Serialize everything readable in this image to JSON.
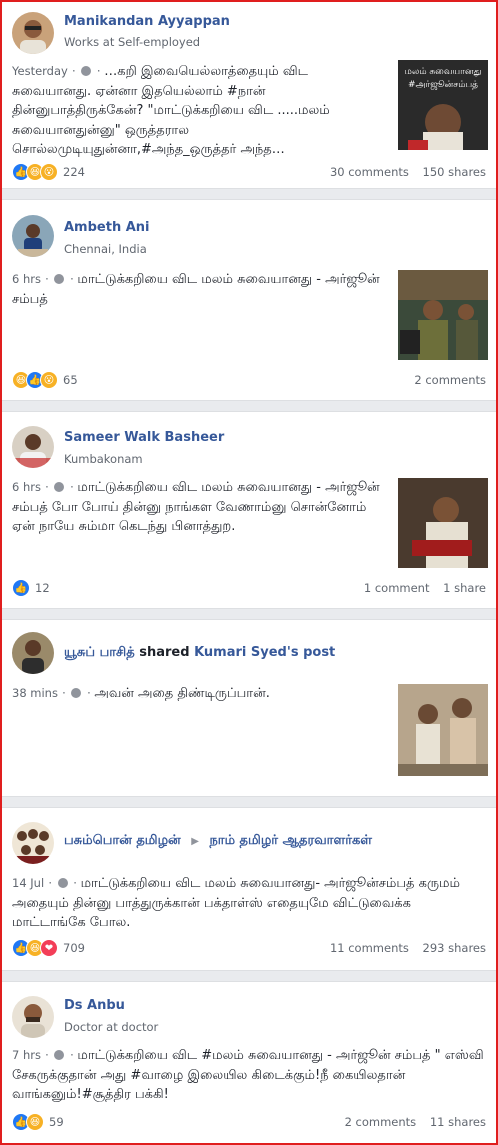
{
  "posts": [
    {
      "author": "Manikandan Ayyappan",
      "subtitle": "Works at Self-employed",
      "time": "Yesterday",
      "text": "…கறி இவையெல்லாத்தையும் விட சுவையானது. ஏன்னா இதயெல்லாம் #நான் தின்னுபாத்திருக்கேன்? \"மாட்டுக்கறியை விட .....மலம் சுவையானதுன்னு\" ஒருத்தரால சொல்லமுடியுதுன்னா,#அந்த_ஒருத்தர் அந்த…",
      "thumb_caption": "மலம் சுவையானது\n#அர்ஜூன்சம்பத்",
      "reactions": [
        "like-icon",
        "haha-icon",
        "wow-icon"
      ],
      "reaction_count": "224",
      "comments": "30 comments",
      "shares": "150 shares"
    },
    {
      "author": "Ambeth Ani",
      "subtitle": "Chennai, India",
      "time": "6 hrs",
      "text": "மாட்டுக்கறியை விட மலம் சுவையானது - அர்ஜூன் சம்பத்",
      "reactions": [
        "haha-icon",
        "like-icon",
        "wow-icon"
      ],
      "reaction_count": "65",
      "comments": "2 comments",
      "shares": ""
    },
    {
      "author": "Sameer Walk Basheer",
      "subtitle": "Kumbakonam",
      "time": "6 hrs",
      "text": "மாட்டுக்கறியை விட மலம் சுவையானது - அர்ஜூன் சம்பத் போ போய் தின்னு நாங்கள வேணாம்னு சொன்னோம் ஏன் நாயே சும்மா கெடந்து பினாத்துற.",
      "reactions": [
        "like-icon"
      ],
      "reaction_count": "12",
      "comments": "1 comment",
      "shares": "1 share"
    },
    {
      "author": "யூசுப் பாசித்",
      "shared_word": "shared",
      "shared_target": "Kumari Syed's post",
      "time": "38 mins",
      "text": "அவன் அதை திண்டிருப்பான்.",
      "reactions": [],
      "reaction_count": "",
      "comments": "",
      "shares": ""
    },
    {
      "author": "பசும்பொன் தமிழன்",
      "group": "நாம் தமிழர் ஆதரவாளர்கள்",
      "time": "14 Jul",
      "text": "மாட்டுக்கறியை விட மலம் சுவையானது- அர்ஜூன்சம்பத் கருமம் அதையும் தின்னு பாத்துருக்கான் பக்தாள்ஸ் எதையுமே விட்டுவைக்க மாட்டாங்கே போல.",
      "reactions": [
        "like-icon",
        "haha-icon",
        "love-icon"
      ],
      "reaction_count": "709",
      "comments": "11 comments",
      "shares": "293 shares"
    },
    {
      "author": "Ds Anbu",
      "subtitle": "Doctor at doctor",
      "time": "7 hrs",
      "text": "மாட்டுக்கறியை விட #மலம் சுவையானது - அர்ஜூன் சம்பத் \" எஸ்வி சேகருக்குதான் அது #வாழை இலையில கிடைக்கும்!நீ கையிலதான் வாங்கனும்!#சூத்திர பக்கி!",
      "reactions": [
        "like-icon",
        "haha-icon"
      ],
      "reaction_count": "59",
      "comments": "2 comments",
      "shares": "11 shares"
    }
  ]
}
